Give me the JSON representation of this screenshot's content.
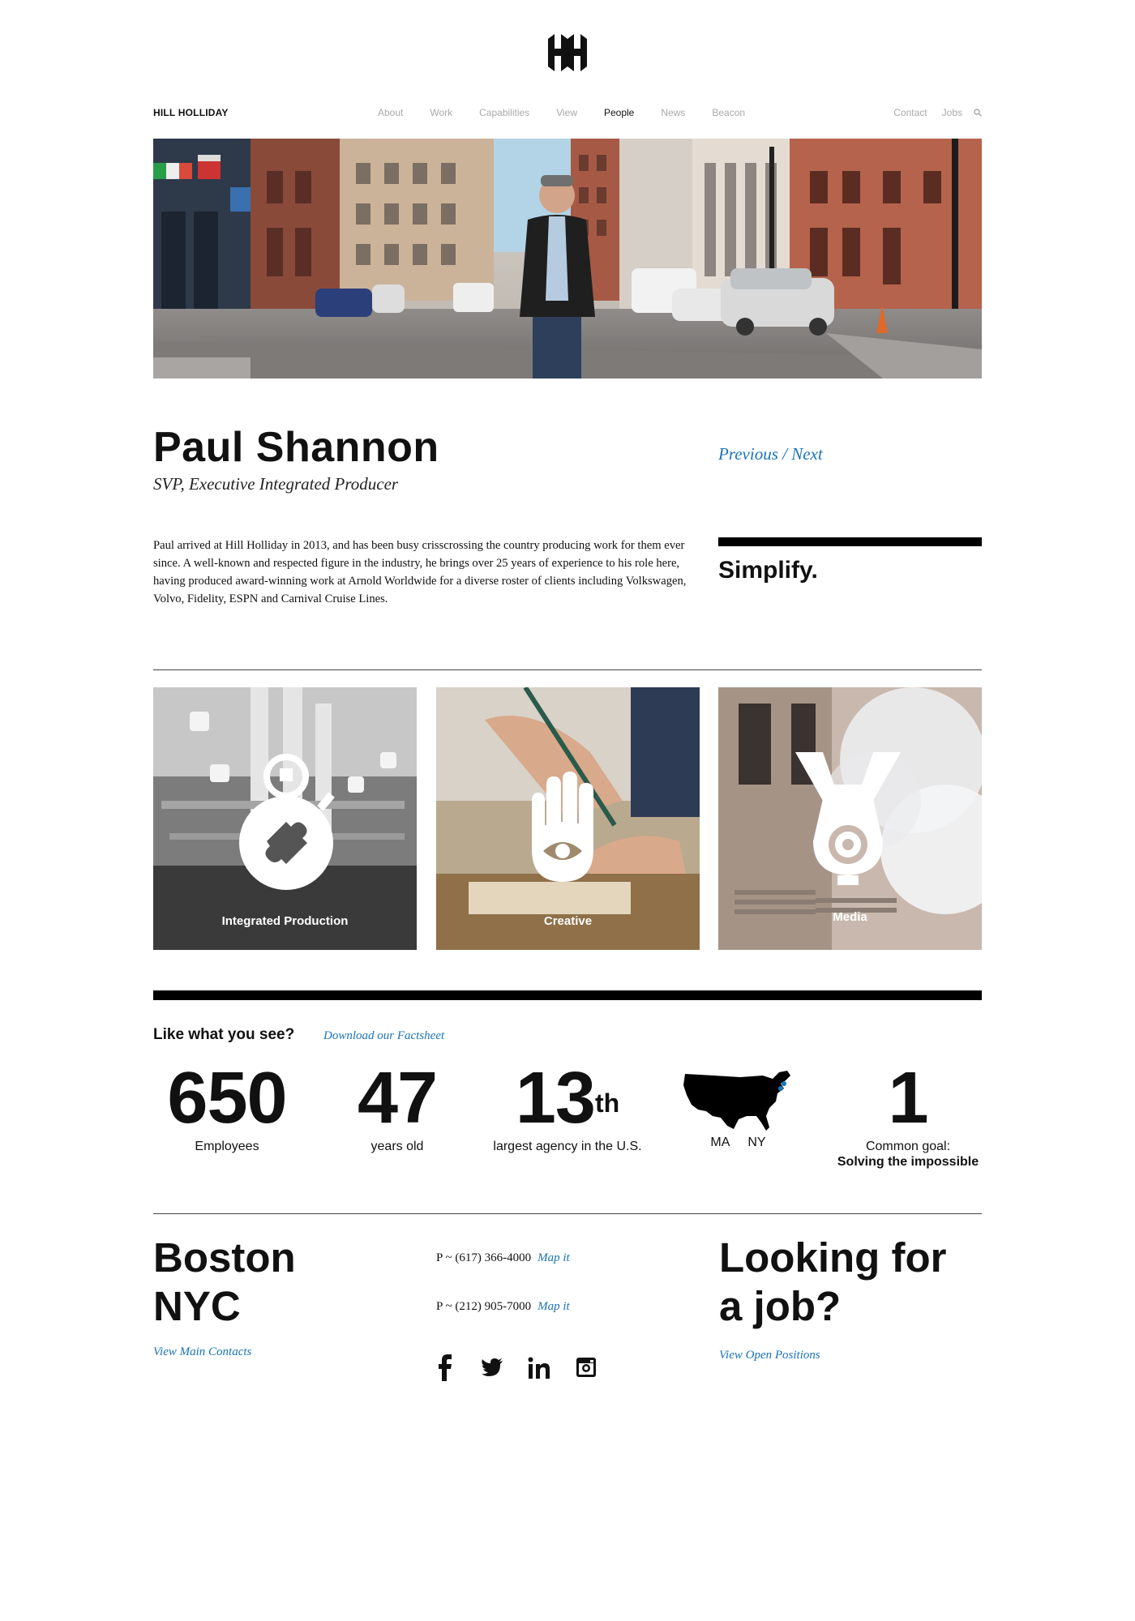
{
  "brand": {
    "name": "HILL HOLLIDAY",
    "logo_icon": "hh-monogram-logo"
  },
  "nav": {
    "items": [
      {
        "label": "About",
        "active": false
      },
      {
        "label": "Work",
        "active": false
      },
      {
        "label": "Capabilities",
        "active": false
      },
      {
        "label": "View",
        "active": false
      },
      {
        "label": "People",
        "active": true
      },
      {
        "label": "News",
        "active": false
      },
      {
        "label": "Beacon",
        "active": false
      }
    ],
    "right": {
      "contact": "Contact",
      "jobs": "Jobs",
      "search_icon": "search-icon"
    }
  },
  "hero": {
    "image": "photo-man-in-leather-jacket-on-boston-street"
  },
  "profile": {
    "name": "Paul Shannon",
    "title": "SVP, Executive Integrated Producer",
    "previous": "Previous",
    "separator": " / ",
    "next": "Next",
    "bio": "Paul arrived at Hill Holliday in 2013, and has been busy crisscrossing the country producing work for them ever since. A well-known and respected figure in the industry, he brings over 25 years of experience to his role here, having produced award-winning work at Arnold Worldwide for a diverse roster of clients including Volkswagen, Volvo, Fidelity, ESPN and Carnival Cruise Lines.",
    "quote": "Simplify."
  },
  "capabilities": [
    {
      "label": "Integrated Production",
      "icon": "stopwatch-puzzle-icon"
    },
    {
      "label": "Creative",
      "icon": "hand-eye-icon"
    },
    {
      "label": "Media",
      "icon": "target-funnel-icon"
    }
  ],
  "stats": {
    "heading": "Like what you see?",
    "download_link": "Download our Factsheet",
    "employees_num": "650",
    "employees_label": "Employees",
    "years_num": "47",
    "years_label": "years old",
    "rank_num": "13",
    "rank_suffix": "th",
    "rank_label": "largest agency in the U.S.",
    "map_icon": "usa-map-icon",
    "loc_ma": "MA",
    "loc_ny": "NY",
    "goal_num": "1",
    "goal_label": "Common goal:",
    "goal_strong": "Solving the impossible"
  },
  "footer": {
    "city1": "Boston",
    "city2": "NYC",
    "contacts_link": "View Main Contacts",
    "phone1": "P ~ (617) 366-4000",
    "phone2": "P ~ (212) 905-7000",
    "map_link": "Map it",
    "social": [
      "facebook-icon",
      "twitter-icon",
      "linkedin-icon",
      "instagram-icon"
    ],
    "job_line1": "Looking for",
    "job_line2": "a job?",
    "positions_link": "View Open Positions"
  },
  "colors": {
    "link": "#1a73b8",
    "text": "#111111",
    "nav_muted": "#a9a9a9"
  }
}
